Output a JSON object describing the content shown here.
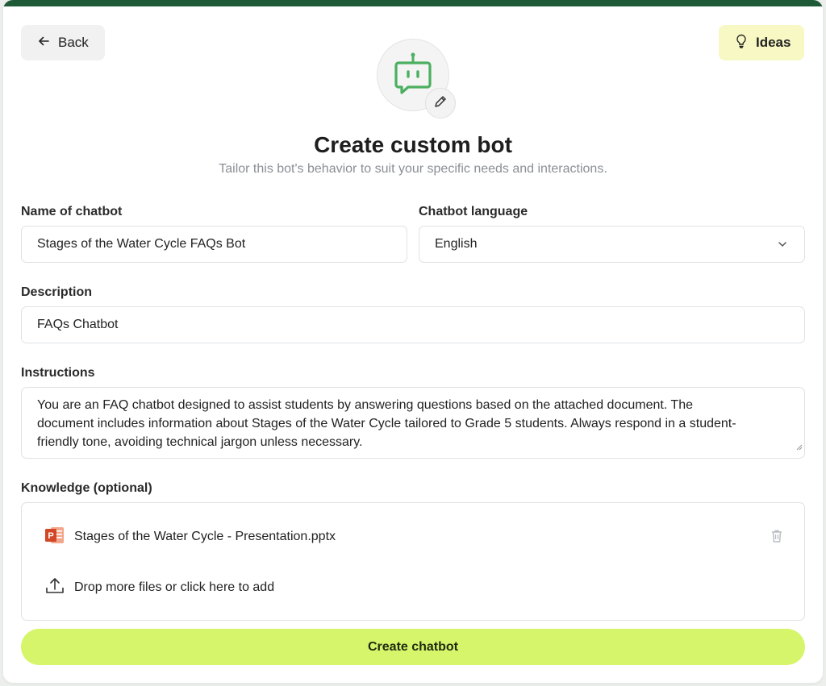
{
  "header": {
    "back_label": "Back",
    "ideas_label": "Ideas",
    "title": "Create custom bot",
    "subtitle": "Tailor this bot's behavior to suit your specific needs and interactions."
  },
  "form": {
    "name": {
      "label": "Name of chatbot",
      "value": "Stages of the Water Cycle FAQs Bot"
    },
    "language": {
      "label": "Chatbot language",
      "value": "English"
    },
    "description": {
      "label": "Description",
      "value": "FAQs Chatbot"
    },
    "instructions": {
      "label": "Instructions",
      "line1": "You are an FAQ chatbot designed to assist students by answering questions based on the attached document. The",
      "line2": "document includes information about Stages of the Water Cycle tailored to Grade 5 students. Always respond in a student-",
      "line3": "friendly tone, avoiding technical jargon unless necessary."
    },
    "knowledge": {
      "label": "Knowledge (optional)",
      "file_name": "Stages of the Water Cycle - Presentation.pptx",
      "drop_text": "Drop more files or click here to add"
    }
  },
  "actions": {
    "create_label": "Create chatbot"
  },
  "icons": {
    "back": "arrow-left-icon",
    "ideas": "lightbulb-icon",
    "avatar": "chat-bot-icon",
    "edit": "pencil-icon",
    "dropdown": "chevron-down-icon",
    "file": "powerpoint-file-icon",
    "delete": "trash-icon",
    "upload": "upload-icon"
  },
  "colors": {
    "topbar": "#1f5a38",
    "accent_button": "#d7f56b",
    "ideas_button": "#f7f8c4",
    "bot_icon": "#4caf60",
    "powerpoint": "#d24726"
  }
}
